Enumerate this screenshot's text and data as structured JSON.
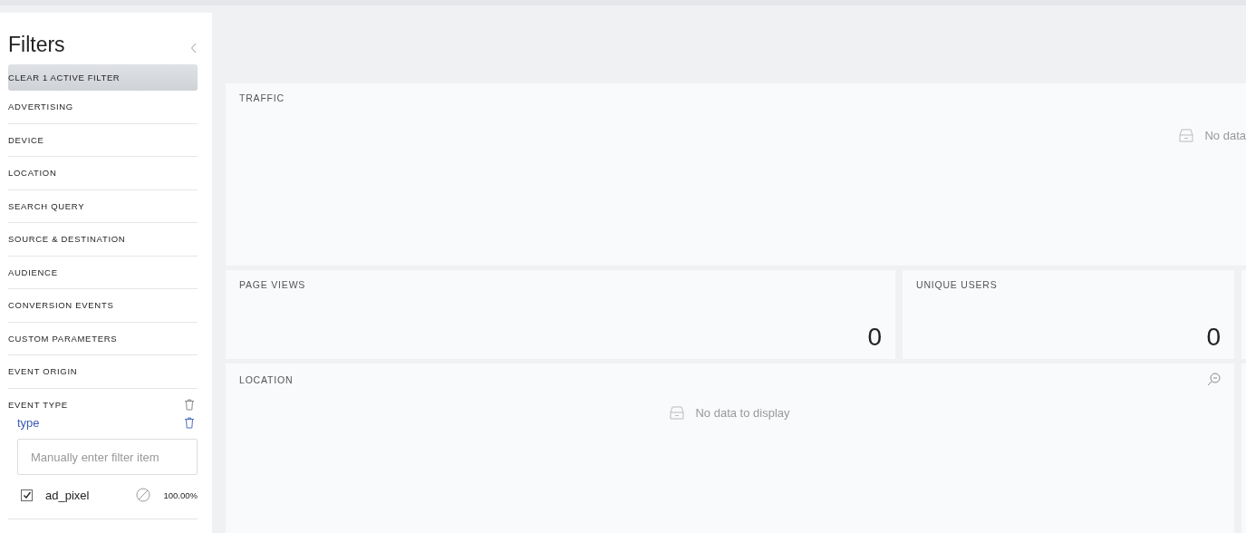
{
  "sidebar": {
    "title": "Filters",
    "clear_button": "CLEAR 1 ACTIVE FILTER",
    "filters": [
      {
        "label": "ADVERTISING"
      },
      {
        "label": "DEVICE"
      },
      {
        "label": "LOCATION"
      },
      {
        "label": "SEARCH QUERY"
      },
      {
        "label": "SOURCE & DESTINATION"
      },
      {
        "label": "AUDIENCE"
      },
      {
        "label": "CONVERSION EVENTS"
      },
      {
        "label": "CUSTOM PARAMETERS"
      },
      {
        "label": "EVENT ORIGIN"
      },
      {
        "label": "EVENT TYPE",
        "field": "type",
        "placeholder": "Manually enter filter item",
        "values": [
          {
            "label": "ad_pixel",
            "checked": true,
            "share": "100.00%"
          }
        ]
      }
    ]
  },
  "cards": [
    {
      "kind": "chart",
      "title": "TRAFFIC",
      "empty": "No data"
    },
    {
      "kind": "metric",
      "title": "PAGE VIEWS",
      "value": "0"
    },
    {
      "kind": "metric",
      "title": "UNIQUE USERS",
      "value": "0"
    },
    {
      "kind": "map",
      "title": "LOCATION",
      "empty": "No data to display"
    }
  ]
}
